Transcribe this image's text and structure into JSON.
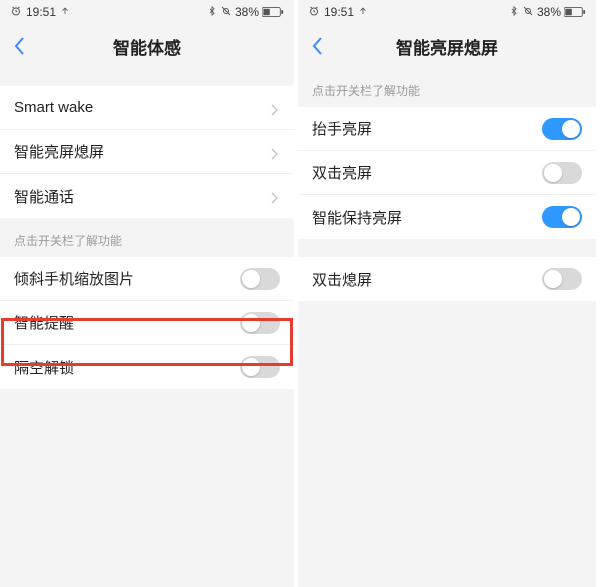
{
  "status": {
    "time": "19:51",
    "battery_pct": "38%"
  },
  "left": {
    "title": "智能体感",
    "nav": [
      {
        "label": "Smart wake"
      },
      {
        "label": "智能亮屏熄屏"
      },
      {
        "label": "智能通话"
      }
    ],
    "hint": "点击开关栏了解功能",
    "toggles": [
      {
        "label": "倾斜手机缩放图片",
        "on": false
      },
      {
        "label": "智能提醒",
        "on": false
      },
      {
        "label": "隔空解锁",
        "on": false,
        "highlighted": true
      }
    ]
  },
  "right": {
    "title": "智能亮屏熄屏",
    "hint": "点击开关栏了解功能",
    "group1": [
      {
        "label": "抬手亮屏",
        "on": true
      },
      {
        "label": "双击亮屏",
        "on": false
      },
      {
        "label": "智能保持亮屏",
        "on": true
      }
    ],
    "group2": [
      {
        "label": "双击熄屏",
        "on": false
      }
    ]
  }
}
